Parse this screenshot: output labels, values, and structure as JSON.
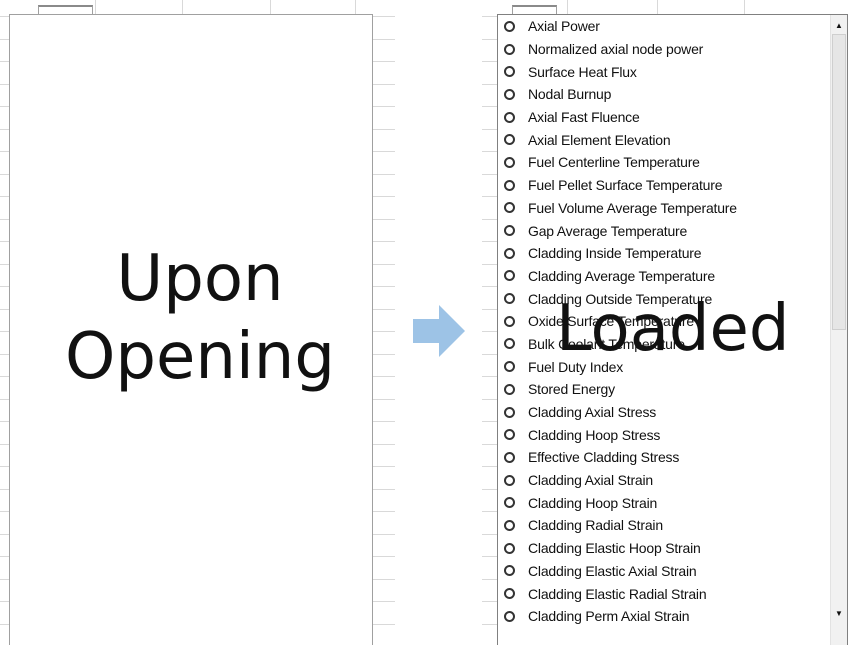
{
  "captions": {
    "before": "Upon\nOpening",
    "after": "Loaded"
  },
  "arrow": {
    "icon": "right-arrow-icon",
    "color": "#9dc3e6"
  },
  "output_list": {
    "items": [
      "Axial Power",
      "Normalized axial node power",
      "Surface Heat Flux",
      "Nodal Burnup",
      "Axial Fast Fluence",
      "Axial Element Elevation",
      "Fuel Centerline Temperature",
      "Fuel Pellet Surface Temperature",
      "Fuel Volume Average Temperature",
      "Gap Average Temperature",
      "Cladding Inside Temperature",
      "Cladding Average Temperature",
      "Cladding Outside Temperature",
      "Oxide Surface Temperature",
      "Bulk Coolant Temperature",
      "Fuel Duty Index",
      "Stored Energy",
      "Cladding Axial Stress",
      "Cladding Hoop Stress",
      "Effective Cladding Stress",
      "Cladding Axial Strain",
      "Cladding Hoop Strain",
      "Cladding Radial Strain",
      "Cladding Elastic Hoop Strain",
      "Cladding Elastic Axial Strain",
      "Cladding Elastic Radial Strain",
      "Cladding Perm Axial Strain"
    ]
  },
  "scrollbar": {
    "up_icon": "scroll-up-arrow-icon",
    "down_icon": "scroll-down-arrow-icon"
  }
}
